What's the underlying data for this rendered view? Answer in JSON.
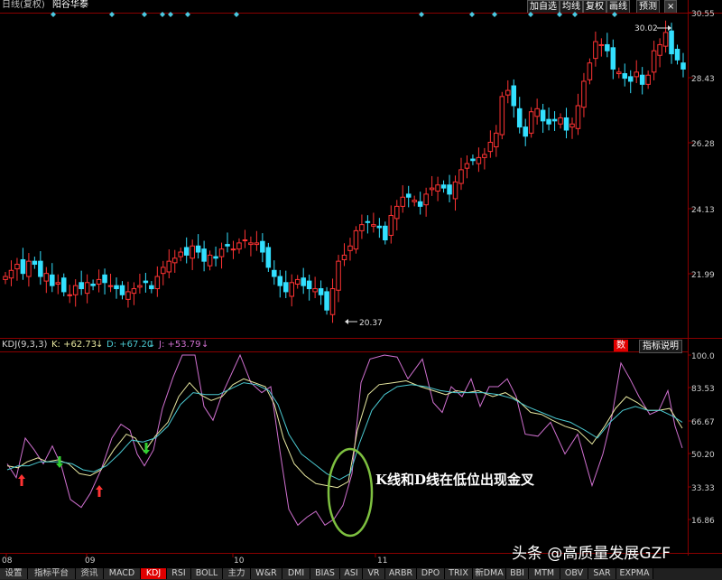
{
  "header": {
    "title": "日线(复权)",
    "stock_name": "阳谷华泰",
    "buttons": [
      "加自选",
      "均线",
      "复权",
      "画线",
      "预测"
    ],
    "close_glyph": "×"
  },
  "price_axis": {
    "labels": [
      "30.55",
      "28.43",
      "26.28",
      "24.13",
      "21.99"
    ],
    "high_label": "30.02",
    "low_label": "20.37"
  },
  "kdj": {
    "title": "KDJ(9,3,3)",
    "k_label": "K: +62.73",
    "d_label": "D: +67.20",
    "j_label": "J: +53.79",
    "k_color": "#e8e8a0",
    "d_color": "#4ac8d0",
    "j_color": "#d070d0",
    "axis_labels": [
      "100.0",
      "83.53",
      "66.67",
      "50.20",
      "33.33",
      "16.86"
    ],
    "side_buttons": [
      "数",
      "指标说明"
    ]
  },
  "x_axis": {
    "labels": [
      "08",
      "09",
      "10",
      "11"
    ]
  },
  "annotation": {
    "text": "K线和D线在低位出现金叉"
  },
  "watermark": {
    "text": "头条 @高质量发展GZF"
  },
  "bottom_tabs": [
    "设置",
    "指标平台",
    "资讯",
    "MACD",
    "KDJ",
    "RSI",
    "BOLL",
    "主力",
    "W&R",
    "DMI",
    "BIAS",
    "ASI",
    "VR",
    "ARBR",
    "DPO",
    "TRIX",
    "新DMA",
    "BBI",
    "MTM",
    "OBV",
    "SAR",
    "EXPMA"
  ],
  "active_tab": "KDJ",
  "colors": {
    "up": "#ff3333",
    "down": "#33e0ff",
    "grid": "#8a0000",
    "golden_cross_circle": "#7ec040",
    "buy_arrow": "#ff3333",
    "sell_arrow": "#30d030"
  }
}
